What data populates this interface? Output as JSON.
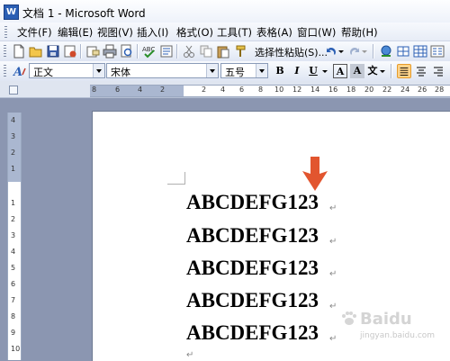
{
  "window": {
    "title": "文档 1 - Microsoft Word",
    "app_icon_letter": "W"
  },
  "menu": [
    "文件(F)",
    "编辑(E)",
    "视图(V)",
    "插入(I)",
    "格式(O)",
    "工具(T)",
    "表格(A)",
    "窗口(W)",
    "帮助(H)"
  ],
  "toolbar": {
    "paste_special_label": "选择性粘贴(S)...",
    "buttons": [
      "new-icon",
      "open-icon",
      "save-icon",
      "permission-icon",
      "email-icon",
      "print-icon",
      "print-preview-icon",
      "spelling-icon",
      "research-icon",
      "cut-icon",
      "copy-icon",
      "paste-icon",
      "format-painter-icon",
      "undo-icon",
      "redo-icon",
      "hyperlink-icon",
      "tables-borders-icon",
      "insert-table-icon",
      "columns-icon"
    ]
  },
  "formatting": {
    "style_value": "正文",
    "font_value": "宋体",
    "size_value": "五号",
    "buttons": [
      "B",
      "I",
      "U",
      "A",
      "A",
      "文"
    ]
  },
  "ruler": {
    "h_numbers": [
      "8",
      "6",
      "4",
      "2",
      "2",
      "4",
      "6",
      "8",
      "10",
      "12",
      "14",
      "16",
      "18",
      "20",
      "22",
      "24",
      "26",
      "28",
      "30"
    ],
    "v_numbers": [
      "4",
      "3",
      "2",
      "1",
      "1",
      "2",
      "3",
      "4",
      "5",
      "6",
      "7",
      "8",
      "9",
      "10"
    ]
  },
  "document": {
    "lines": [
      "ABCDEFG123",
      "ABCDEFG123",
      "ABCDEFG123",
      "ABCDEFG123",
      "ABCDEFG123"
    ],
    "paragraph_mark": "↵"
  },
  "watermark": {
    "text": "Baidu",
    "sub": "jingyan.baidu.com"
  },
  "colors": {
    "annotation_arrow": "#e2552f"
  }
}
